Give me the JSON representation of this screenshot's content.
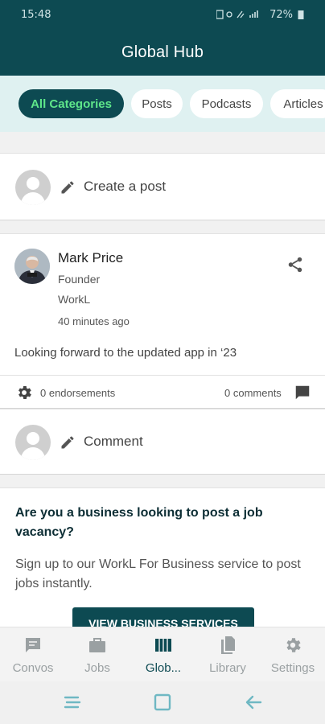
{
  "status": {
    "time": "15:48",
    "battery": "72%"
  },
  "header": {
    "title": "Global Hub"
  },
  "chips": [
    "All Categories",
    "Posts",
    "Podcasts",
    "Articles"
  ],
  "create_post": {
    "label": "Create a post"
  },
  "post": {
    "author": "Mark Price",
    "role": "Founder",
    "company": "WorkL",
    "time": "40 minutes ago",
    "body": "Looking forward to the updated app in ‘23",
    "endorsements": "0 endorsements",
    "comments": "0 comments",
    "comment_placeholder": "Comment"
  },
  "promo": {
    "heading": "Are you a business looking to post a job vacancy?",
    "text": "Sign up to our WorkL For Business service to post jobs instantly.",
    "button": "VIEW BUSINESS SERVICES"
  },
  "nav": [
    {
      "label": "Convos",
      "icon": "chat-icon"
    },
    {
      "label": "Jobs",
      "icon": "briefcase-icon"
    },
    {
      "label": "Glob...",
      "icon": "globe-hub-icon"
    },
    {
      "label": "Library",
      "icon": "library-icon"
    },
    {
      "label": "Settings",
      "icon": "gear-icon"
    }
  ],
  "colors": {
    "brand": "#0d4a52",
    "accent": "#5ee68a",
    "chip_bar": "#dff1f1"
  }
}
